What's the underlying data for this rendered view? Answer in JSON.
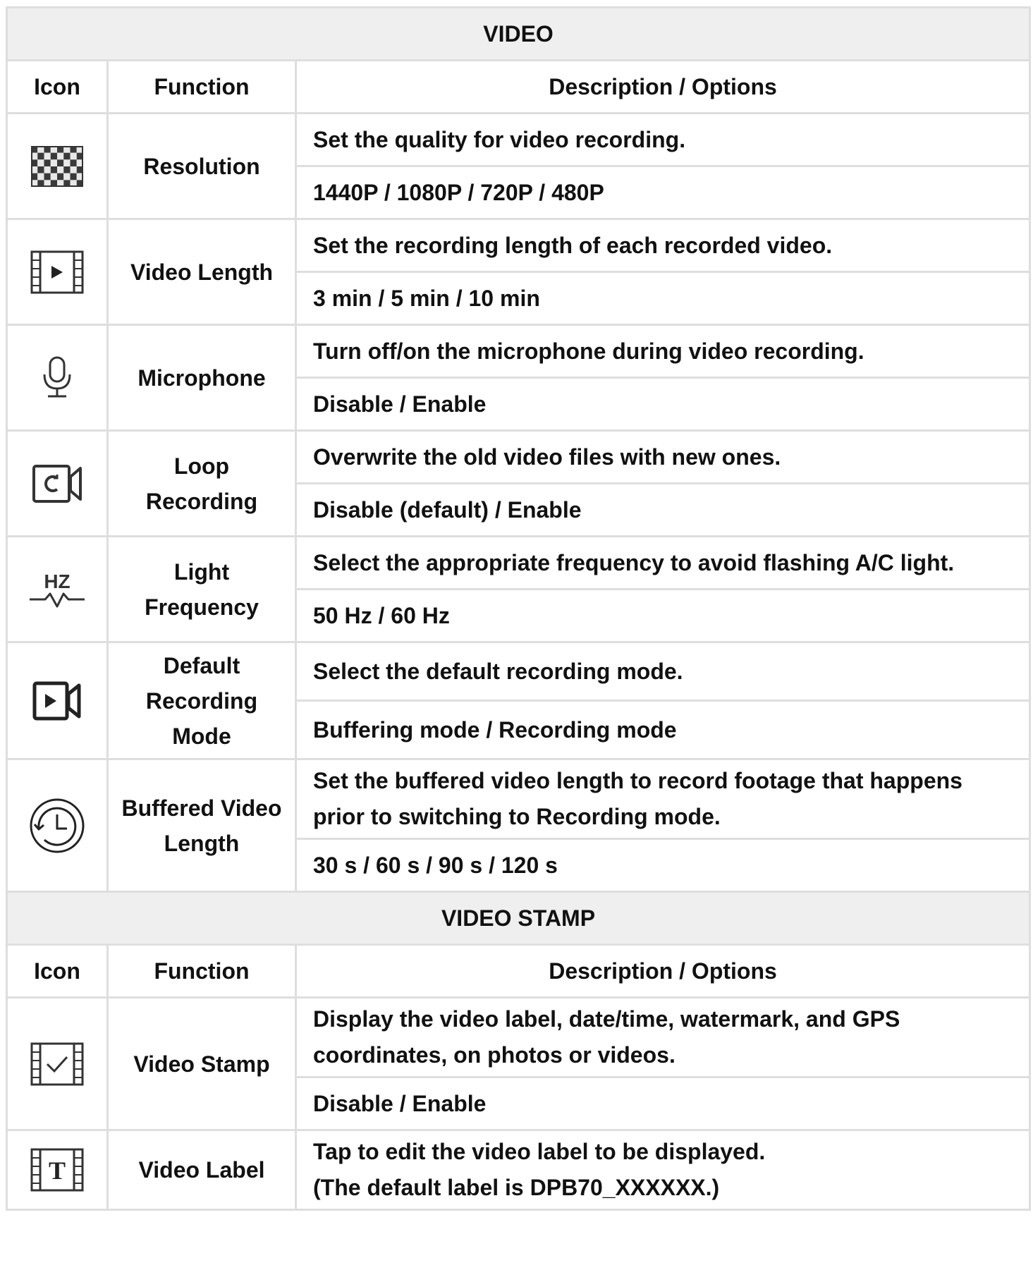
{
  "sections": [
    {
      "title": "VIDEO",
      "headers": {
        "icon": "Icon",
        "function": "Function",
        "description": "Description / Options"
      },
      "rows": [
        {
          "icon": "checkerboard-icon",
          "function": "Resolution",
          "description": "Set the quality for video recording.",
          "options": "1440P / 1080P / 720P / 480P"
        },
        {
          "icon": "film-play-icon",
          "function": "Video Length",
          "description": "Set the recording length of each recorded video.",
          "options": "3 min / 5 min / 10 min"
        },
        {
          "icon": "microphone-icon",
          "function": "Microphone",
          "description": "Turn off/on the microphone during video recording.",
          "options": "Disable / Enable"
        },
        {
          "icon": "loop-camera-icon",
          "function": "Loop Recording",
          "description": "Overwrite the old video files with new ones.",
          "options": "Disable (default) / Enable"
        },
        {
          "icon": "hz-frequency-icon",
          "icon_text": "HZ",
          "function": "Light Frequency",
          "description": "Select the appropriate frequency to avoid flashing A/C light.",
          "options": "50 Hz / 60 Hz"
        },
        {
          "icon": "video-camera-play-icon",
          "function": "Default Recording Mode",
          "description": "Select the default recording mode.",
          "options": "Buffering mode / Recording mode"
        },
        {
          "icon": "history-clock-icon",
          "function": "Buffered Video Length",
          "description": "Set the buffered video length to record footage that happens prior to switching to Recording mode.",
          "options": "30 s / 60 s / 90 s / 120 s"
        }
      ]
    },
    {
      "title": "VIDEO STAMP",
      "headers": {
        "icon": "Icon",
        "function": "Function",
        "description": "Description / Options"
      },
      "rows": [
        {
          "icon": "film-check-icon",
          "function": "Video Stamp",
          "description": "Display the video label, date/time, watermark, and GPS coordinates, on photos or videos.",
          "options": "Disable / Enable"
        },
        {
          "icon": "film-text-icon",
          "icon_text": "T",
          "function": "Video Label",
          "description": "Tap to edit the video label to be displayed.",
          "options": "(The default label is DPB70_XXXXXX.)"
        }
      ]
    }
  ]
}
